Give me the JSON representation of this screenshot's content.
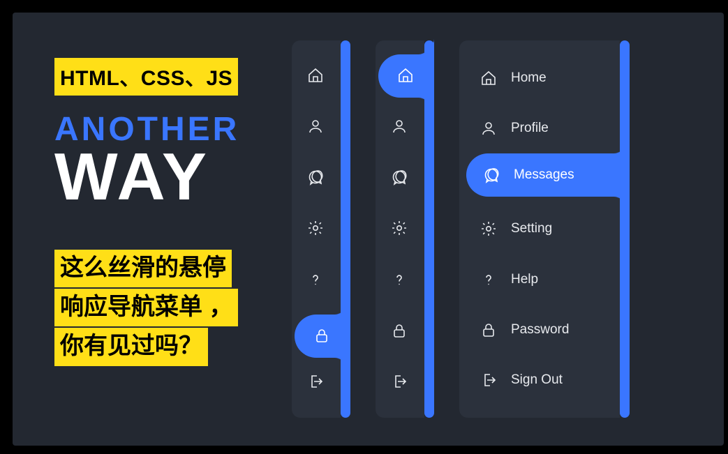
{
  "colors": {
    "accent": "#3a76ff",
    "highlight": "#ffdf17",
    "panel": "#2b313c",
    "bg": "#232831"
  },
  "badge_top": "HTML、CSS、JS",
  "title": {
    "line1": "ANOTHER",
    "line2": "WAY"
  },
  "subtitle": {
    "line1": "这么丝滑的悬停",
    "line2": "响应导航菜单 ，",
    "line3": "你有见过吗？"
  },
  "navA": {
    "active_index": 5,
    "active_icon": "lock-icon",
    "items": [
      "home-icon",
      "user-icon",
      "chat-icon",
      "gear-icon",
      "help-icon",
      "lock-icon",
      "signout-icon"
    ]
  },
  "navB": {
    "active_index": 0,
    "active_icon": "home-icon",
    "items": [
      "home-icon",
      "user-icon",
      "chat-icon",
      "gear-icon",
      "help-icon",
      "lock-icon",
      "signout-icon"
    ]
  },
  "navC": {
    "active_index": 2,
    "items": [
      {
        "icon": "home-icon",
        "label": "Home"
      },
      {
        "icon": "user-icon",
        "label": "Profile"
      },
      {
        "icon": "chat-icon",
        "label": "Messages"
      },
      {
        "icon": "gear-icon",
        "label": "Setting"
      },
      {
        "icon": "help-icon",
        "label": "Help"
      },
      {
        "icon": "lock-icon",
        "label": "Password"
      },
      {
        "icon": "signout-icon",
        "label": "Sign Out"
      }
    ]
  }
}
